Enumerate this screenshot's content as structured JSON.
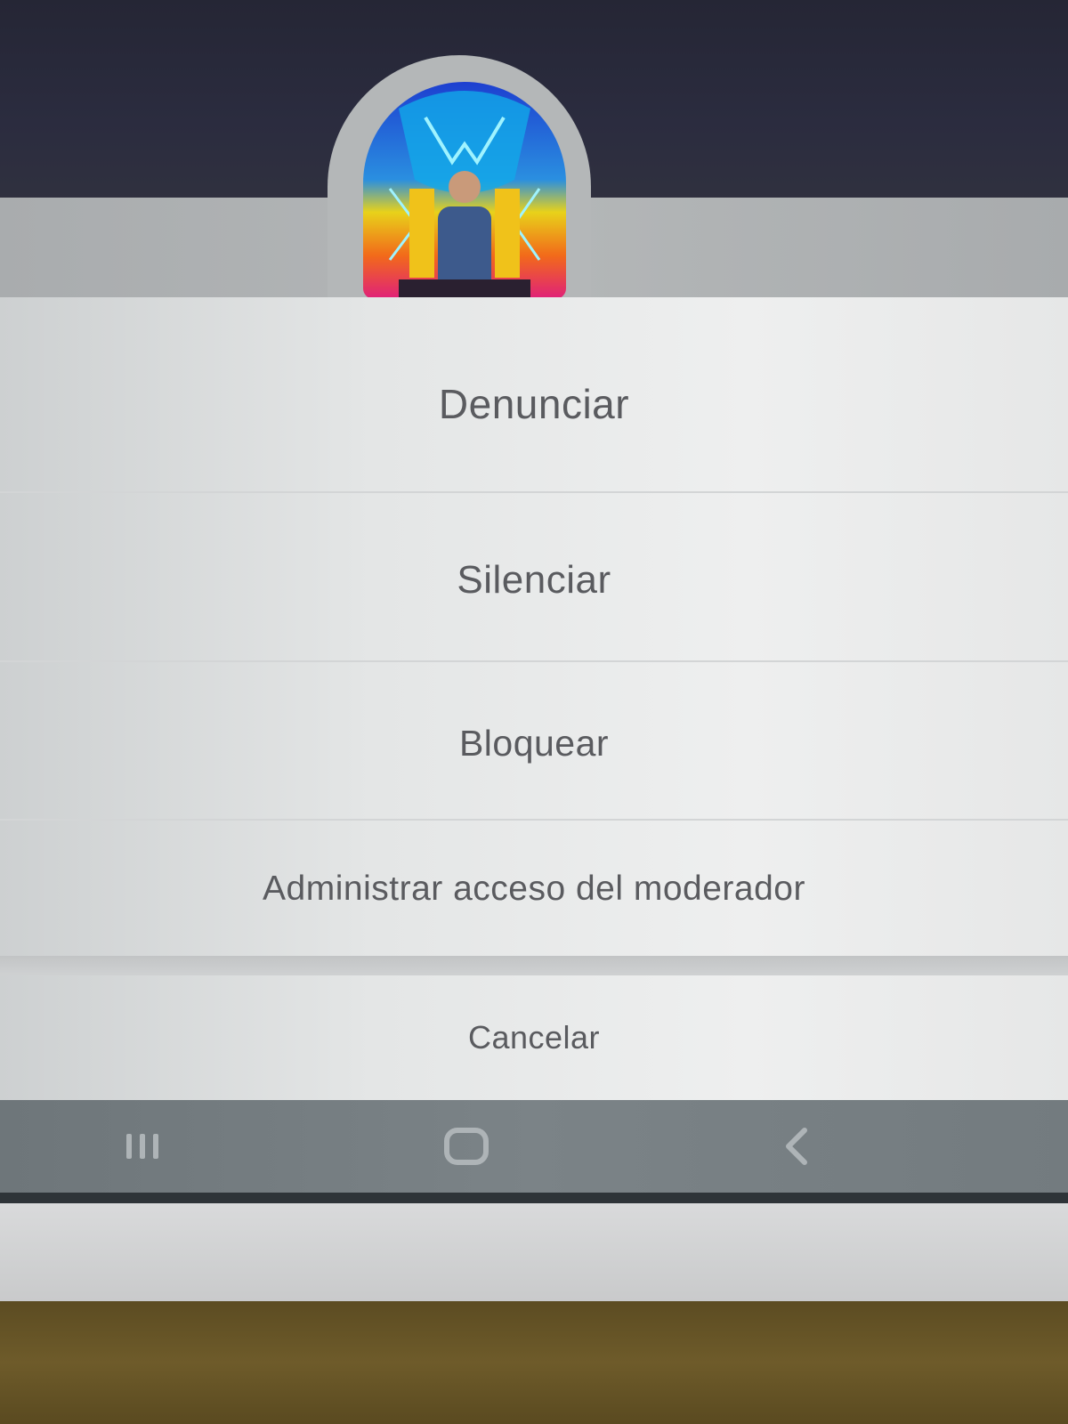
{
  "profile": {
    "avatar_icon": "profile-photo"
  },
  "menu": {
    "items": [
      {
        "label": "Denunciar"
      },
      {
        "label": "Silenciar"
      },
      {
        "label": "Bloquear"
      },
      {
        "label": "Administrar acceso del moderador"
      }
    ],
    "cancel_label": "Cancelar"
  },
  "system_nav": {
    "recents_icon": "recents-icon",
    "home_icon": "home-icon",
    "back_icon": "back-icon"
  }
}
